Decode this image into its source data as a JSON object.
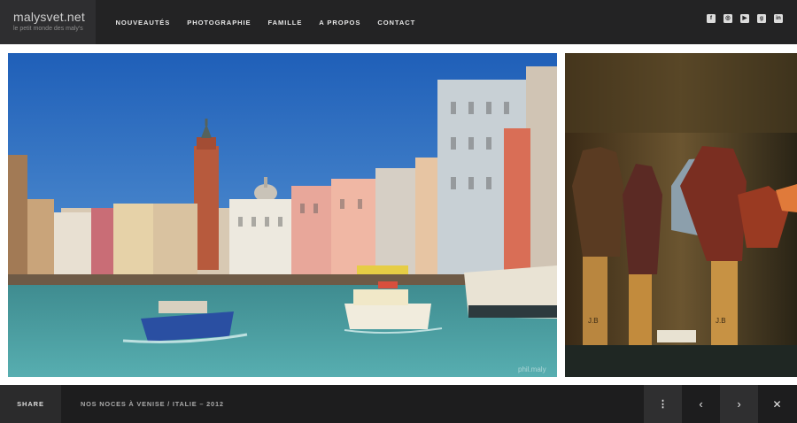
{
  "brand": {
    "title": "malysvet.net",
    "tagline": "le petit monde des maly's"
  },
  "nav": {
    "items": [
      "NOUVEAUTÉS",
      "PHOTOGRAPHIE",
      "FAMILLE",
      "A PROPOS",
      "CONTACT"
    ]
  },
  "social": {
    "icons": [
      "facebook-icon",
      "instagram-icon",
      "youtube-icon",
      "google-plus-icon",
      "linkedin-icon"
    ],
    "glyphs": [
      "f",
      "◎",
      "▶",
      "g+",
      "in"
    ]
  },
  "gallery": {
    "main_photo": {
      "subject": "Grand Canal, Venise",
      "watermark": "phil.maly"
    },
    "side_photo": {
      "subject": "Leather gloves in shop window"
    }
  },
  "footer": {
    "share_label": "SHARE",
    "caption": "NOS NOCES À VENISE / ITALIE – 2012",
    "info_glyph": "⋮",
    "prev_glyph": "‹",
    "next_glyph": "›",
    "close_glyph": "✕"
  },
  "colors": {
    "header_bg": "#232324",
    "logo_bg": "#2e2e30",
    "footer_bg": "#1d1d1e",
    "sky": "#2f6fc0",
    "water": "#4c9ea2"
  }
}
